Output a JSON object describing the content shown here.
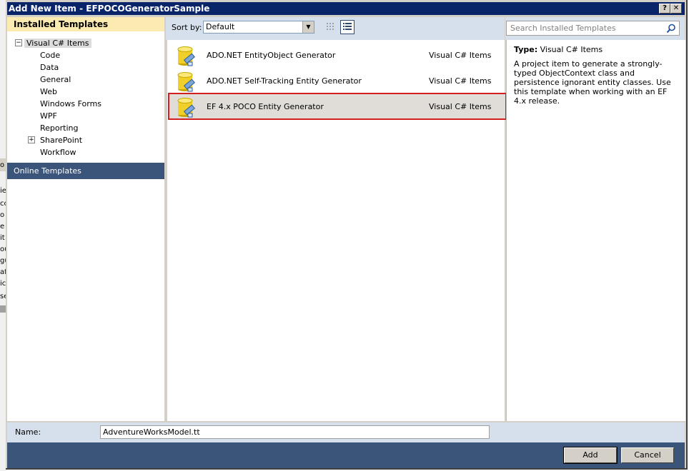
{
  "window": {
    "title": "Add New Item - EFPOCOGeneratorSample",
    "help_glyph": "?",
    "close_glyph": "✕"
  },
  "background_window": {
    "fragments": [
      "o",
      "ie",
      "cc",
      "o",
      "e",
      "it",
      "ou",
      "gu",
      "af",
      "ic",
      "se"
    ]
  },
  "left_pane": {
    "installed_header": "Installed Templates",
    "tree": {
      "root": {
        "label": "Visual C# Items",
        "expander": "−"
      },
      "children": [
        {
          "label": "Code"
        },
        {
          "label": "Data"
        },
        {
          "label": "General"
        },
        {
          "label": "Web"
        },
        {
          "label": "Windows Forms"
        },
        {
          "label": "WPF"
        },
        {
          "label": "Reporting"
        },
        {
          "label": "SharePoint",
          "expander": "+"
        },
        {
          "label": "Workflow"
        }
      ]
    },
    "online_templates": "Online Templates"
  },
  "toolbar": {
    "sort_label": "Sort by:",
    "sort_value": "Default",
    "sort_arrow": "▼"
  },
  "templates": [
    {
      "name": "ADO.NET EntityObject Generator",
      "category": "Visual C# Items",
      "icon": "database-template-icon"
    },
    {
      "name": "ADO.NET Self-Tracking Entity Generator",
      "category": "Visual C# Items",
      "icon": "database-template-icon"
    },
    {
      "name": "EF 4.x POCO Entity Generator",
      "category": "Visual C# Items",
      "icon": "database-template-icon",
      "selected": true
    }
  ],
  "details": {
    "search_placeholder": "Search Installed Templates",
    "type_label": "Type:",
    "type_value": "Visual C# Items",
    "description": "A project item to generate a strongly-typed ObjectContext class and persistence ignorant entity classes. Use this template when working with an EF 4.x release."
  },
  "footer": {
    "name_label": "Name:",
    "name_value": "AdventureWorksModel.tt",
    "add_label": "Add",
    "cancel_label": "Cancel"
  },
  "colors": {
    "title_bar": "#0a246a",
    "installed_header_bg": "#fcebb0",
    "online_templates_bg": "#3a5579",
    "selection_border": "#d21f1f",
    "toolbar_bg": "#d6e0ec"
  }
}
